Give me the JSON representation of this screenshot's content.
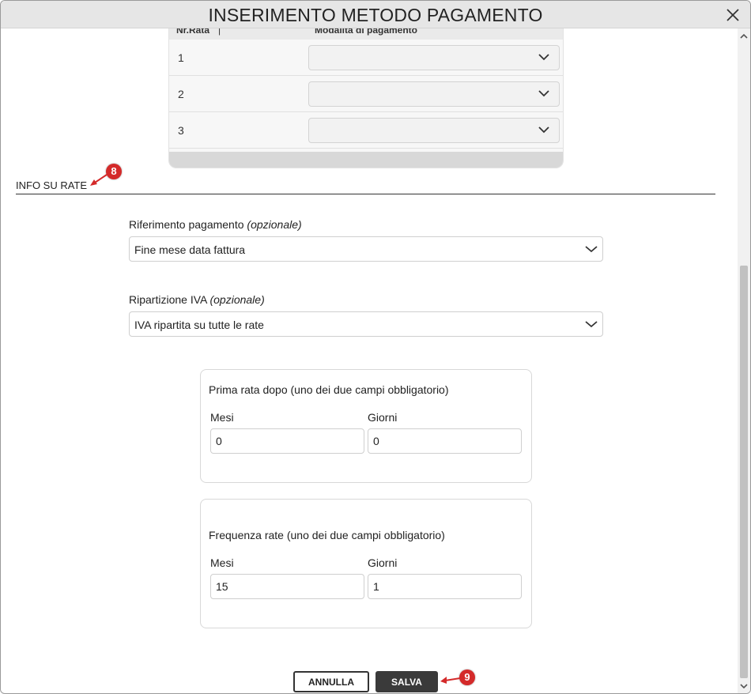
{
  "dialog": {
    "title": "INSERIMENTO METODO PAGAMENTO"
  },
  "rate_table": {
    "col_nr": "Nr.Rata",
    "col_mode": "Modalità di pagamento",
    "rows": [
      {
        "nr": "1",
        "mode": ""
      },
      {
        "nr": "2",
        "mode": ""
      },
      {
        "nr": "3",
        "mode": ""
      }
    ]
  },
  "section": {
    "title": "INFO SU RATE"
  },
  "riferimento": {
    "label": "Riferimento pagamento",
    "optional": "(opzionale)",
    "value": "Fine mese data fattura"
  },
  "ripartizione": {
    "label": "Ripartizione IVA",
    "optional": "(opzionale)",
    "value": "IVA ripartita su tutte le rate"
  },
  "prima_rata": {
    "title": "Prima rata dopo (uno dei due campi obbligatorio)",
    "mesi_label": "Mesi",
    "mesi_value": "0",
    "giorni_label": "Giorni",
    "giorni_value": "0"
  },
  "frequenza": {
    "title": "Frequenza rate (uno dei due campi obbligatorio)",
    "mesi_label": "Mesi",
    "mesi_value": "15",
    "giorni_label": "Giorni",
    "giorni_value": "1"
  },
  "buttons": {
    "cancel": "ANNULLA",
    "save": "SALVA"
  },
  "markers": {
    "m8": "8",
    "m9": "9"
  },
  "colors": {
    "marker": "#d42a2a",
    "save_bg": "#3a3a3a"
  }
}
